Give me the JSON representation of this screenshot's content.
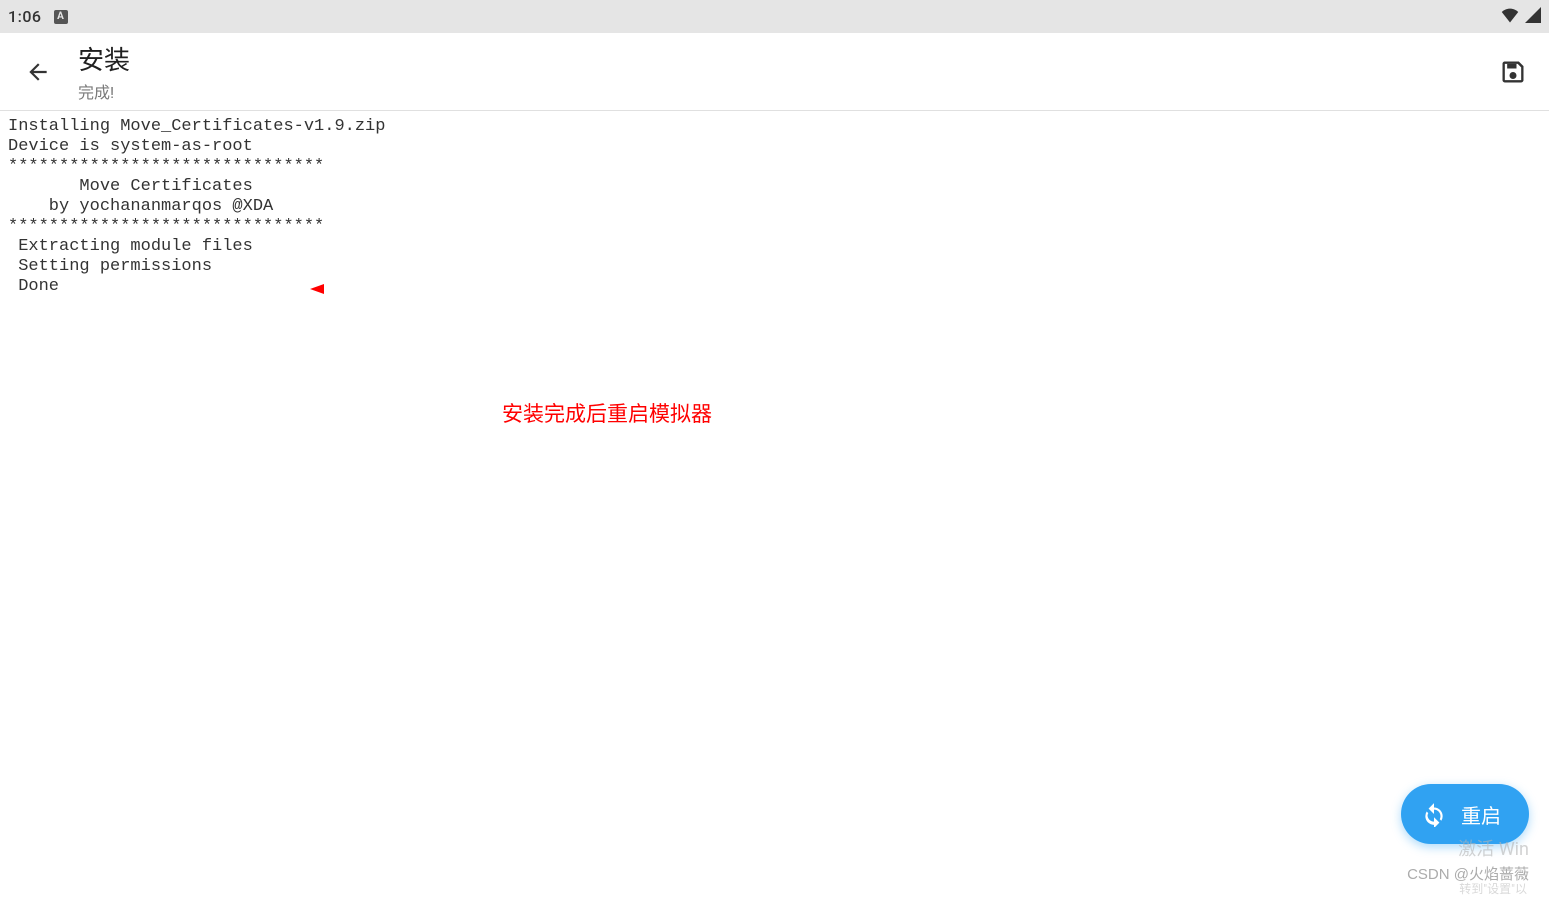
{
  "status_bar": {
    "time": "1:06",
    "keyboard_indicator": "A"
  },
  "app_bar": {
    "title": "安装",
    "subtitle": "完成!"
  },
  "log": {
    "lines": "Installing Move_Certificates-v1.9.zip\nDevice is system-as-root\n*******************************\n       Move Certificates\n    by yochananmarqos @XDA\n*******************************\n Extracting module files\n Setting permissions\n Done"
  },
  "annotation": {
    "text": "安装完成后重启模拟器"
  },
  "fab": {
    "label": "重启"
  },
  "watermarks": {
    "w1": "激活 Win",
    "w2": "CSDN @火焰蔷薇",
    "w3": "转到\"设置\"以"
  }
}
